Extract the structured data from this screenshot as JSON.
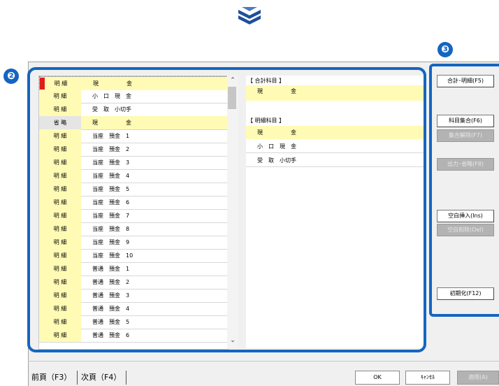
{
  "marker2": "❷",
  "marker3": "❸",
  "left_list": [
    {
      "kind": "明 細",
      "name": "現　　　　　金",
      "kind_hl": true,
      "name_hl": true,
      "selected": true
    },
    {
      "kind": "明 細",
      "name": "小　口　現　金",
      "kind_hl": true,
      "name_hl": false
    },
    {
      "kind": "明 細",
      "name": "受　取　小切手",
      "kind_hl": true,
      "name_hl": false
    },
    {
      "kind": "省 略",
      "name": "現　　　　　金",
      "kind_hl": false,
      "kind_gray": true,
      "name_hl": true
    },
    {
      "kind": "明 細",
      "name": "当座　預金　1",
      "kind_hl": true,
      "name_hl": false
    },
    {
      "kind": "明 細",
      "name": "当座　預金　2",
      "kind_hl": true,
      "name_hl": false
    },
    {
      "kind": "明 細",
      "name": "当座　預金　3",
      "kind_hl": true,
      "name_hl": false
    },
    {
      "kind": "明 細",
      "name": "当座　預金　4",
      "kind_hl": true,
      "name_hl": false
    },
    {
      "kind": "明 細",
      "name": "当座　預金　5",
      "kind_hl": true,
      "name_hl": false
    },
    {
      "kind": "明 細",
      "name": "当座　預金　6",
      "kind_hl": true,
      "name_hl": false
    },
    {
      "kind": "明 細",
      "name": "当座　預金　7",
      "kind_hl": true,
      "name_hl": false
    },
    {
      "kind": "明 細",
      "name": "当座　預金　8",
      "kind_hl": true,
      "name_hl": false
    },
    {
      "kind": "明 細",
      "name": "当座　預金　9",
      "kind_hl": true,
      "name_hl": false
    },
    {
      "kind": "明 細",
      "name": "当座　預金　10",
      "kind_hl": true,
      "name_hl": false
    },
    {
      "kind": "明 細",
      "name": "普通　預金　1",
      "kind_hl": true,
      "name_hl": false
    },
    {
      "kind": "明 細",
      "name": "普通　預金　2",
      "kind_hl": true,
      "name_hl": false
    },
    {
      "kind": "明 細",
      "name": "普通　預金　3",
      "kind_hl": true,
      "name_hl": false
    },
    {
      "kind": "明 細",
      "name": "普通　預金　4",
      "kind_hl": true,
      "name_hl": false
    },
    {
      "kind": "明 細",
      "name": "普通　預金　5",
      "kind_hl": true,
      "name_hl": false
    },
    {
      "kind": "明 細",
      "name": "普通　預金　6",
      "kind_hl": true,
      "name_hl": false
    }
  ],
  "right_panel": {
    "total_header": "【 合計科目 】",
    "total_value": "現　　　　　金",
    "detail_header": "【 明細科目 】",
    "detail_items": [
      "現　　　　　金",
      "小　口　現　金",
      "受　取　小切手"
    ]
  },
  "buttons": {
    "total_detail": "合計･明細(F5)",
    "aggregate": "科目集合(F6)",
    "release": "集合解除(F7)",
    "output_omit": "出力･省略(F8)",
    "insert_blank": "空白挿入(Ins)",
    "delete_blank": "空白削除(Del)",
    "initialize": "初期化(F12)"
  },
  "footer": {
    "prev": "前頁（F3）",
    "next": "次頁（F4）",
    "ok": "OK",
    "cancel": "ｷｬﾝｾﾙ",
    "apply": "適用(A)"
  },
  "colors": {
    "accent": "#1565c0",
    "highlight": "#fffbb5",
    "selection": "#e01c1c"
  }
}
